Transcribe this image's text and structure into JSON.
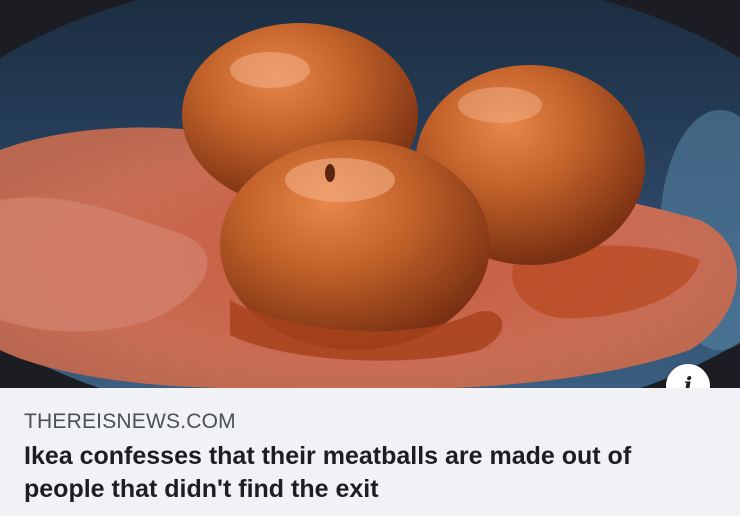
{
  "link_preview": {
    "image_icon": "meatballs-photo",
    "info_button_label": "i",
    "domain": "THEREISNEWS.COM",
    "headline": "Ikea confesses that their meatballs are made out of people that didn't find the exit"
  },
  "colors": {
    "background": "#f0f2f5",
    "domain_text": "#4b4f56",
    "headline_text": "#1c1e21",
    "sauce": "#c8604a",
    "meatball": "#b2541f",
    "bowl": "#2c4766"
  }
}
